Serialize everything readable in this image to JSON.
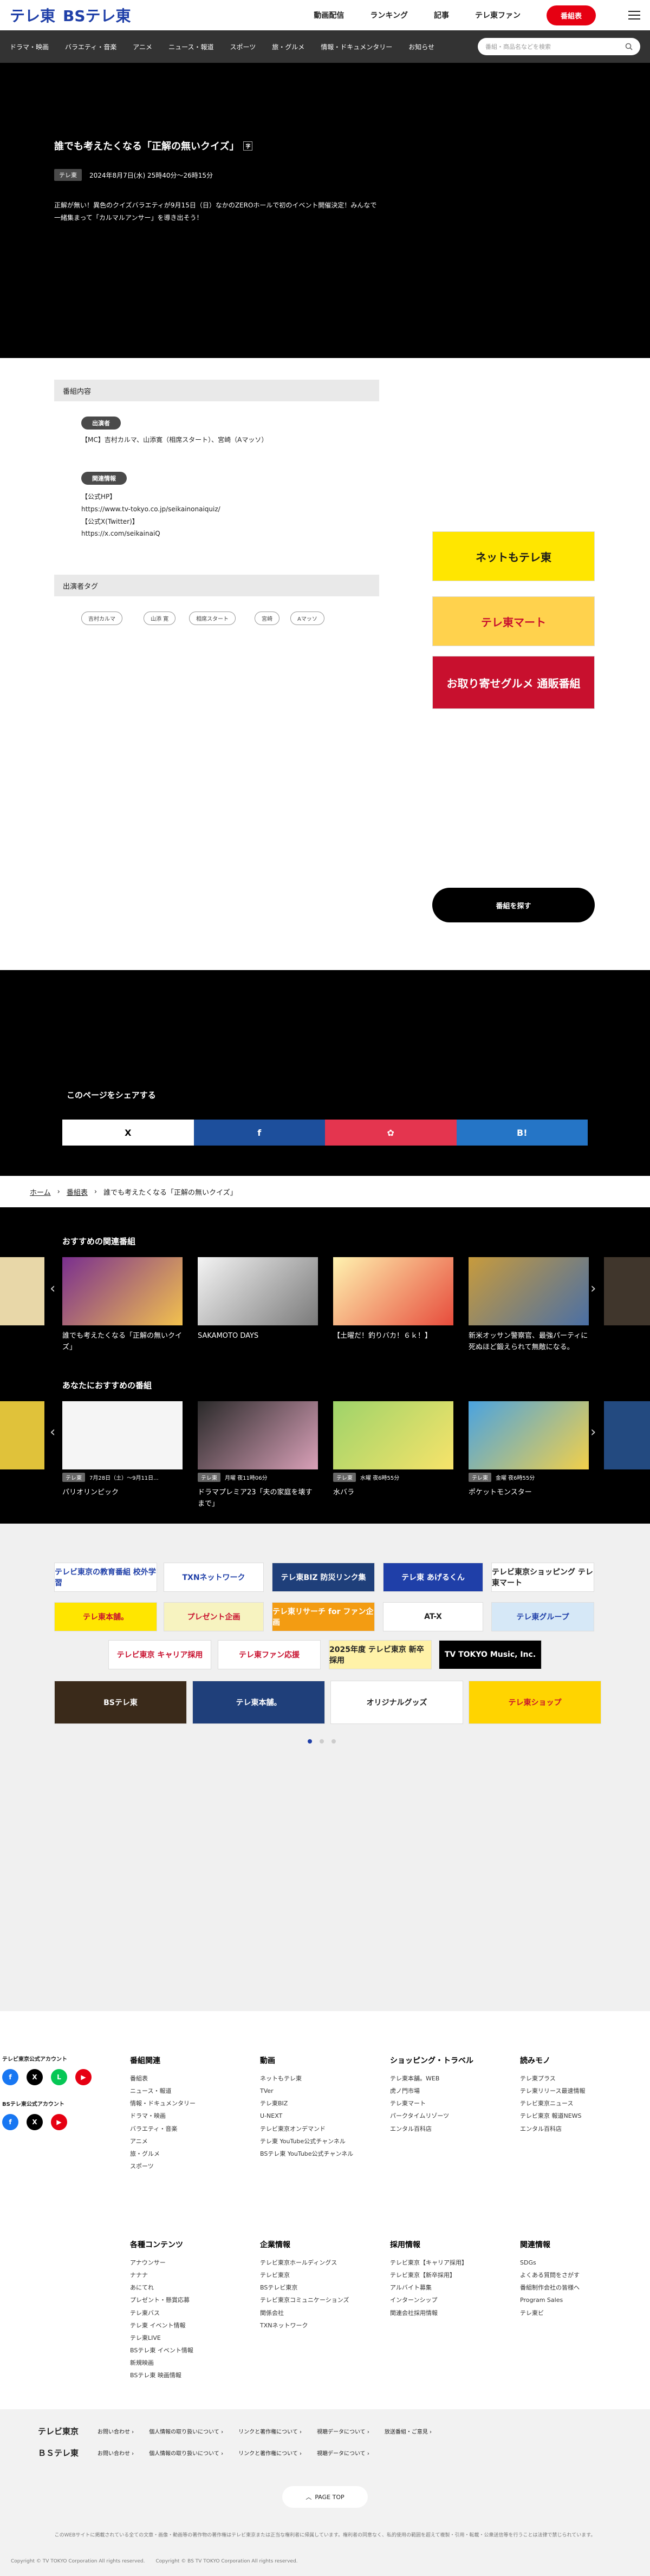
{
  "header": {
    "logo_tx": "テレ東",
    "logo_bs": "BSテレ東",
    "nav": [
      "動画配信",
      "ランキング",
      "記事",
      "テレ東ファン"
    ],
    "program_guide": "番組表"
  },
  "categories": [
    "ドラマ・映画",
    "バラエティ・音楽",
    "アニメ",
    "ニュース・報道",
    "スポーツ",
    "旅・グルメ",
    "情報・ドキュメンタリー",
    "お知らせ"
  ],
  "search": {
    "placeholder": "番組・商品名などを検索"
  },
  "hero": {
    "title": "誰でも考えたくなる「正解の無いクイズ」",
    "cc": "字",
    "channel": "テレ東",
    "datetime": "2024年8月7日(水) 25時40分～26時15分",
    "description": "正解が無い！異色のクイズバラエティが9月15日（日）なかのZEROホールで初のイベント開催決定！みんなで一緒集まって「カルマルアンサー」を導き出そう！"
  },
  "details": {
    "section_title": "番組内容",
    "cast_label": "出演者",
    "cast_text": "【MC】吉村カルマ、山添寛（相席スタート）、宮崎（Aマッソ）",
    "links_label": "関連情報",
    "links": [
      "【公式HP】",
      "https://www.tv-tokyo.co.jp/seikainonaiquiz/",
      "【公式X(Twitter)】",
      "https://x.com/seikainaiQ"
    ],
    "tags_title": "出演者タグ",
    "tags": [
      "吉村カルマ",
      "山添 寛",
      "相席スタート",
      "宮崎",
      "Aマッソ"
    ]
  },
  "side_banners": [
    "ネットもテレ東",
    "テレ東マート",
    "お取り寄せグルメ 通販番組"
  ],
  "find_button": "番組を探す",
  "share": {
    "title": "このページをシェアする",
    "buttons": [
      "X",
      "f",
      "✿",
      "B!"
    ]
  },
  "breadcrumb": [
    "ホーム",
    "番組表",
    "誰でも考えたくなる「正解の無いクイズ」"
  ],
  "recommend": {
    "related_title": "おすすめの関連番組",
    "related": [
      "誰でも考えたくなる「正解の無いクイズ」",
      "SAKAMOTO DAYS",
      "【土曜だ！釣りバカ！６ｋ！】",
      "新米オッサン警察官、最強パーティに死ぬほど鍛えられて無敵になる。"
    ],
    "for_you_title": "あなたにおすすめの番組",
    "for_you": [
      {
        "chip": "テレ東",
        "time": "7月28日（土）～9月11日...",
        "title": "パリオリンピック"
      },
      {
        "chip": "テレ東",
        "time": "月曜 夜11時06分",
        "title": "ドラマプレミア23「夫の家庭を壊すまで」"
      },
      {
        "chip": "テレ東",
        "time": "水曜 夜6時55分",
        "title": "水バラ"
      },
      {
        "chip": "テレ東",
        "time": "金曜 夜6時55分",
        "title": "ポケットモンスター"
      }
    ]
  },
  "link_banners": {
    "row1": [
      "テレビ東京の教育番組 校外学習",
      "TXNネットワーク",
      "テレ東BIZ 防災リンク集",
      "テレ東 あげるくん",
      "テレビ東京ショッピング テレ東マート"
    ],
    "row2": [
      "テレ東本舗。",
      "プレゼント企画",
      "テレ東リサーチ for ファン企画",
      "AT-X",
      "テレ東グループ"
    ],
    "row3": [
      "テレビ東京 キャリア採用",
      "テレ東ファン応援",
      "2025年度 テレビ東京 新卒採用",
      "TV TOKYO Music, Inc."
    ],
    "row4": [
      "BSテレ東",
      "テレ東本舗。",
      "オリジナルグッズ",
      "テレ東ショップ"
    ]
  },
  "footer": {
    "social": [
      "テレビ東京公式アカウント",
      "BSテレ東公式アカウント"
    ],
    "cols": [
      {
        "head": "番組関連",
        "items": [
          "番組表",
          "ニュース・報道",
          "情報・ドキュメンタリー",
          "ドラマ・映画",
          "バラエティ・音楽",
          "アニメ",
          "旅・グルメ",
          "スポーツ"
        ]
      },
      {
        "head": "動画",
        "items": [
          "ネットもテレ東",
          "TVer",
          "テレ東BIZ",
          "U-NEXT",
          "テレビ東京オンデマンド",
          "テレ東 YouTube公式チャンネル",
          "BSテレ東 YouTube公式チャンネル"
        ]
      },
      {
        "head": "ショッピング・トラベル",
        "items": [
          "テレ東本舗。WEB",
          "虎ノ門市場",
          "テレ東マート",
          "パークタイムリゾーツ",
          "エンタル百科店"
        ]
      },
      {
        "head": "読みモノ",
        "items": [
          "テレ東プラス",
          "テレ東リリース最速情報",
          "テレビ東京ニュース",
          "テレビ東京 報道NEWS",
          "エンタル百科店"
        ]
      },
      {
        "head": "各種コンテンツ",
        "items": [
          "アナウンサー",
          "ナナナ",
          "あにてれ",
          "プレゼント・懸賞応募",
          "テレ東バス",
          "テレ東 イベント情報",
          "テレ東LIVE",
          "BSテレ東 イベント情報",
          "新規映画",
          "BSテレ東 映画情報"
        ]
      },
      {
        "head": "企業情報",
        "items": [
          "テレビ東京ホールディングス",
          "テレビ東京",
          "BSテレビ東京",
          "テレビ東京コミュニケーションズ",
          "関係会社",
          "TXNネットワーク"
        ]
      },
      {
        "head": "採用情報",
        "items": [
          "テレビ東京【キャリア採用】",
          "テレビ東京【新卒採用】",
          "アルバイト募集",
          "インターンシップ",
          "関連会社採用情報"
        ]
      },
      {
        "head": "関連情報",
        "items": [
          "SDGs",
          "よくある質問をさがす",
          "番組制作会社の皆様へ",
          "Program Sales",
          "テレ東ビ"
        ]
      }
    ]
  },
  "bottom": {
    "rows": [
      {
        "name": "テレビ東京",
        "links": [
          "お問い合わせ ›",
          "個人情報の取り扱いについて ›",
          "リンクと著作権について ›",
          "視聴データについて ›",
          "放送番組・ご意見 ›"
        ]
      },
      {
        "name": "ＢＳテレ東",
        "links": [
          "お問い合わせ ›",
          "個人情報の取り扱いについて ›",
          "リンクと著作権について ›",
          "視聴データについて ›"
        ]
      }
    ],
    "page_top": "PAGE TOP",
    "disclaimer": "このWEBサイトに掲載されている全ての文章・画像・動画等の著作物の著作権はテレビ東京または正当な権利者に帰属しています。権利者の同意なく、私的使用の範囲を超えて複製・引用・転載・公衆送信等を行うことは法律で禁じられています。",
    "copyright_tx": "Copyright © TV TOKYO Corporation All rights reserved.",
    "copyright_bs": "Copyright © BS TV TOKYO Corporation All rights reserved."
  },
  "colors": {
    "brand_red": "#e60012",
    "brand_blue": "#1f3fa8",
    "dark": "#000000"
  }
}
